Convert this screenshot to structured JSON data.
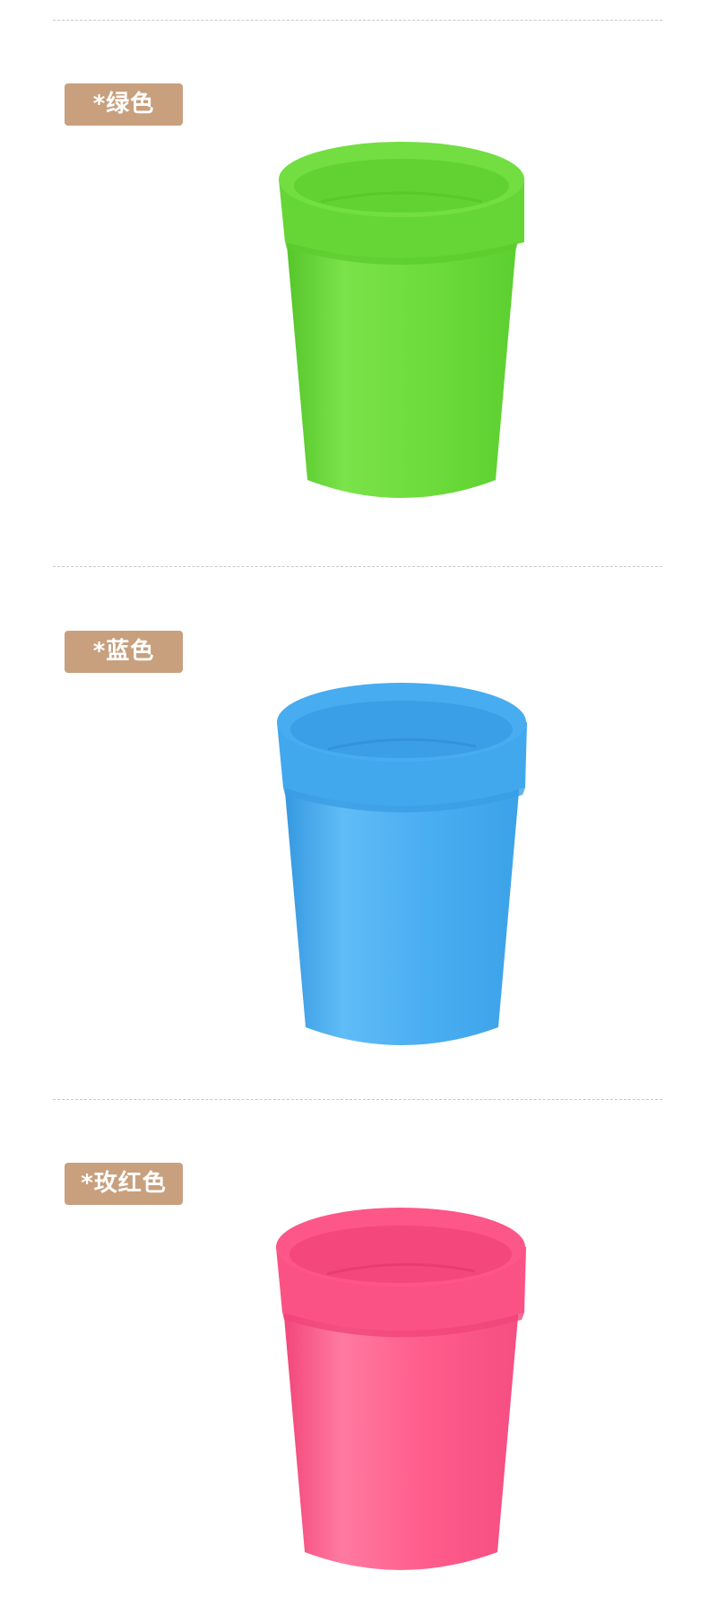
{
  "colors": [
    {
      "label": "*绿色",
      "badge_color": "#c8a07e",
      "cup_color": "#6edc3c",
      "cup_light": "#8ae85a",
      "cup_dark": "#55c52a",
      "icon": "cup-image"
    },
    {
      "label": "*蓝色",
      "badge_color": "#c8a07e",
      "cup_color": "#4aaef2",
      "cup_light": "#6cc0f7",
      "cup_dark": "#3498e0",
      "icon": "cup-image"
    },
    {
      "label": "*玫红色",
      "badge_color": "#c8a07e",
      "cup_color": "#ff5c8c",
      "cup_light": "#ff7ea3",
      "cup_dark": "#f2457a",
      "icon": "cup-image"
    }
  ]
}
